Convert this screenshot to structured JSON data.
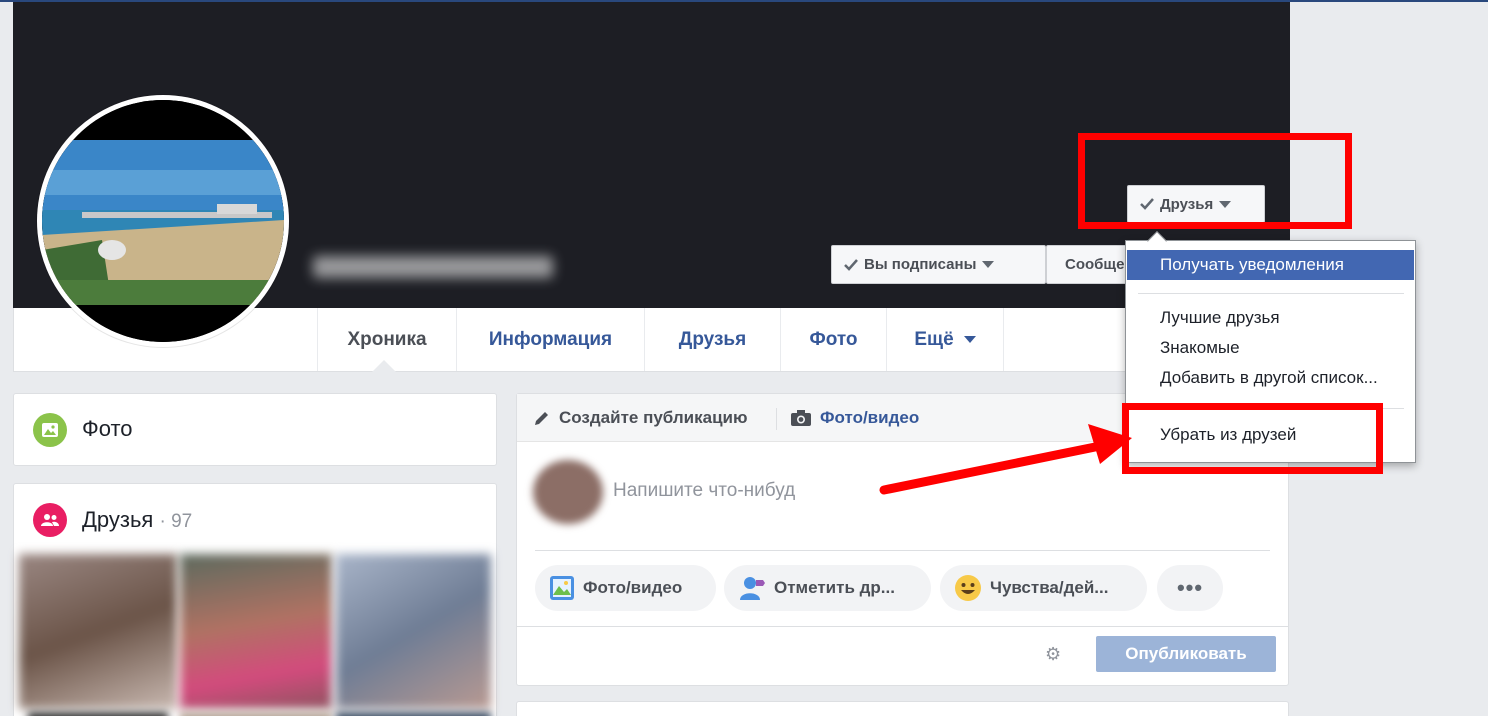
{
  "profile": {
    "name_blurred": "Ольга Ковалёва",
    "buttons": {
      "friends": "Друзья",
      "subscribed": "Вы подписаны",
      "message": "Сообщение"
    }
  },
  "friend_menu": {
    "items": [
      "Получать уведомления",
      "Лучшие друзья",
      "Знакомые",
      "Добавить в другой список...",
      "Убрать из друзей"
    ]
  },
  "tabs": [
    "Хроника",
    "Информация",
    "Друзья",
    "Фото",
    "Ещё"
  ],
  "left_column": {
    "photos_title": "Фото",
    "friends_title": "Друзья",
    "friends_count": "· 97"
  },
  "composer": {
    "create_post": "Создайте публикацию",
    "photo_video_tab": "Фото/видео",
    "placeholder": "Напишите что-нибуд",
    "actions": [
      "Фото/видео",
      "Отметить др...",
      "Чувства/дей...",
      "•••"
    ],
    "publish": "Опубликовать"
  },
  "colors": {
    "accent": "#4267b2",
    "link": "#365899",
    "annotation_red": "#ff0000",
    "cover": "#1d1e24",
    "publish_disabled": "#9cb4d8"
  },
  "icons": [
    "check-icon",
    "caret-down-icon",
    "messenger-icon",
    "photo-icon",
    "friends-icon",
    "pencil-icon",
    "camera-icon",
    "tag-friend-icon",
    "smile-icon",
    "gear-icon"
  ]
}
